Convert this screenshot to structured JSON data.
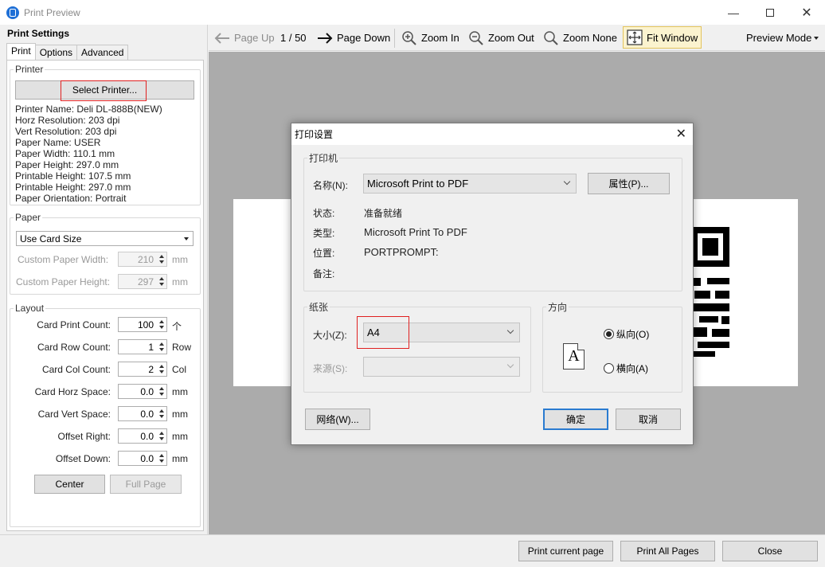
{
  "window": {
    "title": "Print Preview"
  },
  "left_panel": {
    "heading": "Print Settings",
    "tabs": [
      "Print",
      "Options",
      "Advanced"
    ],
    "printer_group": {
      "legend": "Printer",
      "select_button": "Select Printer...",
      "info": [
        "Printer Name: Deli DL-888B(NEW)",
        "Horz Resolution: 203 dpi",
        "Vert Resolution: 203 dpi",
        "Paper Name: USER",
        "Paper Width: 110.1 mm",
        "Paper Height: 297.0 mm",
        "Printable Height: 107.5 mm",
        "Printable Height: 297.0 mm",
        "Paper Orientation: Portrait"
      ]
    },
    "paper_group": {
      "legend": "Paper",
      "size_select": "Use Card Size",
      "custom_width_label": "Custom Paper Width:",
      "custom_width_value": "210",
      "custom_width_unit": "mm",
      "custom_height_label": "Custom Paper Height:",
      "custom_height_value": "297",
      "custom_height_unit": "mm"
    },
    "layout_group": {
      "legend": "Layout",
      "rows": [
        {
          "label": "Card Print Count:",
          "value": "100",
          "unit": "个"
        },
        {
          "label": "Card Row Count:",
          "value": "1",
          "unit": "Row"
        },
        {
          "label": "Card Col Count:",
          "value": "2",
          "unit": "Col"
        },
        {
          "label": "Card Horz Space:",
          "value": "0.0",
          "unit": "mm"
        },
        {
          "label": "Card Vert Space:",
          "value": "0.0",
          "unit": "mm"
        },
        {
          "label": "Offset Right:",
          "value": "0.0",
          "unit": "mm"
        },
        {
          "label": "Offset Down:",
          "value": "0.0",
          "unit": "mm"
        }
      ],
      "center_button": "Center",
      "full_page_button": "Full Page"
    }
  },
  "toolbar": {
    "page_up": "Page Up",
    "page_indicator": "1 / 50",
    "page_down": "Page Down",
    "zoom_in": "Zoom In",
    "zoom_out": "Zoom Out",
    "zoom_none": "Zoom None",
    "fit_window": "Fit Window",
    "preview_mode": "Preview Mode"
  },
  "dialog": {
    "title": "打印设置",
    "printer_legend": "打印机",
    "name_label": "名称(N):",
    "name_value": "Microsoft Print to PDF",
    "properties_button": "属性(P)...",
    "status_label": "状态:",
    "status_value": "准备就绪",
    "type_label": "类型:",
    "type_value": "Microsoft Print To PDF",
    "location_label": "位置:",
    "location_value": "PORTPROMPT:",
    "comment_label": "备注:",
    "comment_value": "",
    "paper_legend": "纸张",
    "size_label": "大小(Z):",
    "size_value": "A4",
    "source_label": "来源(S):",
    "source_value": "",
    "orientation_legend": "方向",
    "orientation_icon_letter": "A",
    "portrait_label": "纵向(O)",
    "landscape_label": "横向(A)",
    "network_button": "网络(W)...",
    "ok_button": "确定",
    "cancel_button": "取消"
  },
  "bottom_bar": {
    "print_current": "Print current page",
    "print_all": "Print All Pages",
    "close": "Close"
  },
  "colors": {
    "accent": "#2a7bd0",
    "highlight": "#e02020",
    "canvas": "#ababab",
    "fit_active_bg": "#fbf3cf"
  }
}
